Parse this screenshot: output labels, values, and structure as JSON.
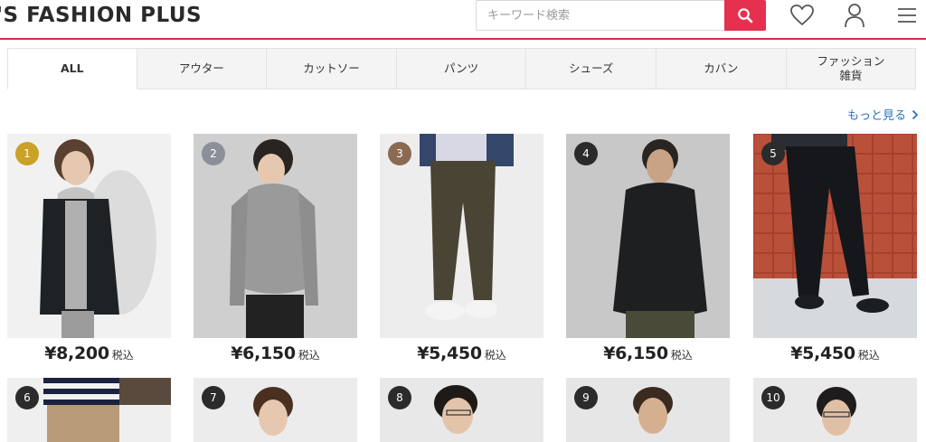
{
  "header": {
    "logo_text": "'S FASHION PLUS",
    "search_placeholder": "キーワード検索",
    "accent_color": "#d72a47",
    "icons": [
      "search-icon",
      "heart-icon",
      "user-icon",
      "menu-icon"
    ]
  },
  "tabs": [
    {
      "label": "ALL",
      "active": true
    },
    {
      "label": "アウター",
      "active": false
    },
    {
      "label": "カットソー",
      "active": false
    },
    {
      "label": "パンツ",
      "active": false
    },
    {
      "label": "シューズ",
      "active": false
    },
    {
      "label": "カバン",
      "active": false
    },
    {
      "label": "ファッション\n雑貨",
      "active": false
    }
  ],
  "more_link": "もっと見る",
  "products": [
    {
      "rank": "1",
      "price": "¥8,200",
      "tax": "税込",
      "badge_color": "#c9a227"
    },
    {
      "rank": "2",
      "price": "¥6,150",
      "tax": "税込",
      "badge_color": "#8a8f99"
    },
    {
      "rank": "3",
      "price": "¥5,450",
      "tax": "税込",
      "badge_color": "#8b6a52"
    },
    {
      "rank": "4",
      "price": "¥6,150",
      "tax": "税込",
      "badge_color": "#2b2b2b"
    },
    {
      "rank": "5",
      "price": "¥5,450",
      "tax": "税込",
      "badge_color": "#2b2b2b"
    },
    {
      "rank": "6",
      "badge_color": "#2b2b2b"
    },
    {
      "rank": "7",
      "badge_color": "#2b2b2b"
    },
    {
      "rank": "8",
      "badge_color": "#2b2b2b"
    },
    {
      "rank": "9",
      "badge_color": "#2b2b2b"
    },
    {
      "rank": "10",
      "badge_color": "#2b2b2b"
    }
  ]
}
